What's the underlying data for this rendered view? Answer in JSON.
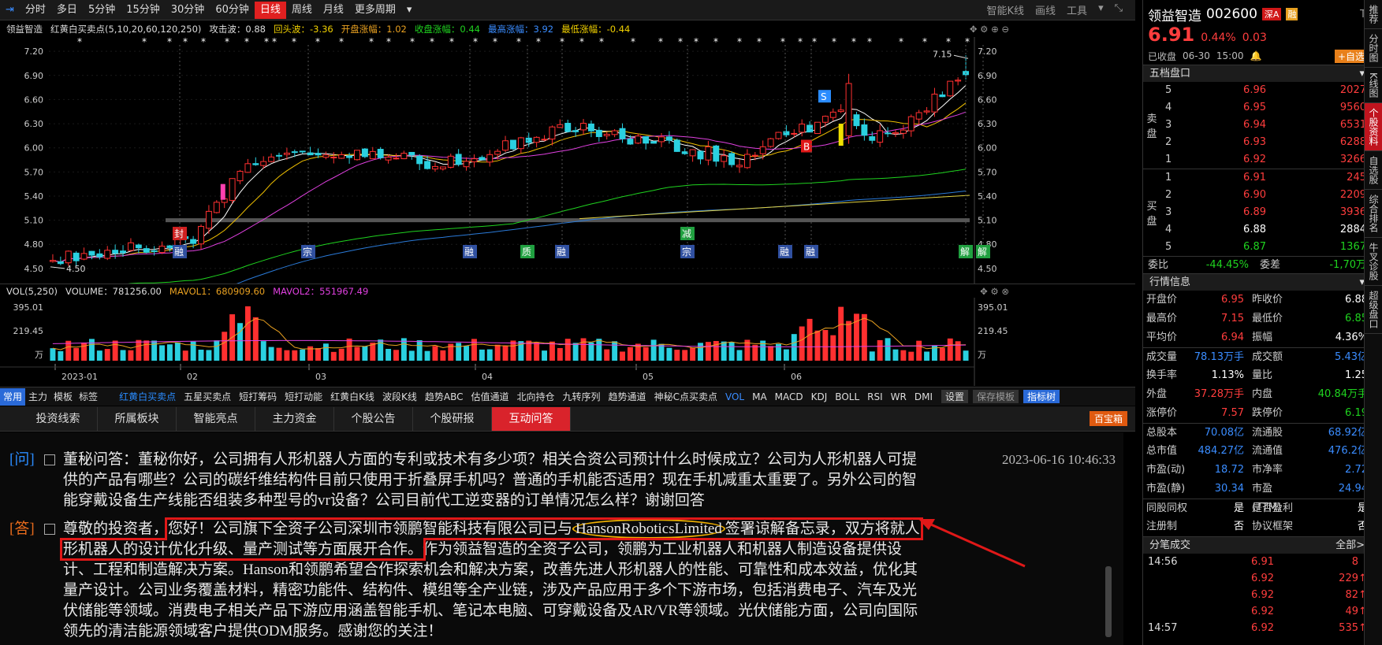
{
  "toolbar": {
    "periods": [
      "分时",
      "多日",
      "5分钟",
      "15分钟",
      "30分钟",
      "60分钟",
      "日线",
      "周线",
      "月线",
      "更多周期"
    ],
    "active_index": 6,
    "right": [
      "智能K线",
      "画线",
      "工具"
    ]
  },
  "indicator_line": {
    "name": "领益智造",
    "ma": "红黄白买卖点(5,10,20,60,120,250)",
    "items": [
      {
        "label": "攻击波：0.88",
        "color": "#ddd"
      },
      {
        "label": "回头波：-3.36",
        "color": "#f0d000"
      },
      {
        "label": "开盘涨幅：1.02",
        "color": "#e8a020"
      },
      {
        "label": "收盘涨幅：0.44",
        "color": "#1fd31f"
      },
      {
        "label": "最高涨幅：3.92",
        "color": "#3a8cff"
      },
      {
        "label": "最低涨幅：-0.44",
        "color": "#f0d000"
      }
    ]
  },
  "vol_line": {
    "name": "VOL(5,250)",
    "volume": "VOLUME：781256.00",
    "mavol1": "MAVOL1：680909.60",
    "mavol2": "MAVOL2：551967.49"
  },
  "chart_data": {
    "type": "candlestick",
    "y_ticks": [
      "7.20",
      "6.90",
      "6.60",
      "6.30",
      "6.00",
      "5.70",
      "5.40",
      "5.10",
      "4.80",
      "4.50"
    ],
    "ylim": [
      4.44,
      7.28
    ],
    "x_ticks": [
      "2023-01",
      "02",
      "03",
      "04",
      "05",
      "06"
    ],
    "annotations": {
      "high": "7.15",
      "low": "4.50"
    },
    "signals": [
      "封",
      "融",
      "宗",
      "融",
      "质",
      "融",
      "减",
      "宗",
      "融",
      "融",
      "解",
      "解"
    ],
    "vol_ticks": [
      "395.01",
      "219.45",
      "万"
    ],
    "seed": 20230630
  },
  "indicator_tabs": {
    "left": [
      "常用",
      "主力",
      "模板",
      "标签"
    ],
    "items": [
      "红黄白买卖点",
      "五星买卖点",
      "短打筹码",
      "短打动能",
      "红黄白K线",
      "波段K线",
      "趋势ABC",
      "估值通道",
      "北向持仓",
      "九转序列",
      "趋势通道",
      "神秘C点买卖点",
      "VOL",
      "MA",
      "MACD",
      "KDJ",
      "BOLL",
      "RSI",
      "WR",
      "DMI"
    ],
    "settings": "设置",
    "save": "保存模板",
    "tree": "指标树"
  },
  "info_tabs": {
    "items": [
      "投资线索",
      "所属板块",
      "智能亮点",
      "主力资金",
      "个股公告",
      "个股研报",
      "互动问答"
    ],
    "active_index": 6,
    "button": "百宝箱"
  },
  "qa": {
    "q_tag": "[问]",
    "question": "董秘问答：董秘你好，公司拥有人形机器人方面的专利或技术有多少项？相关合资公司预计什么时候成立？公司为人形机器人可提供的产品有哪些？公司的碳纤维结构件目前只使用于折叠屏手机吗？普通的手机能否适用？现在手机减重太重要了。另外公司的智能穿戴设备生产线能否组装多种型号的vr设备？公司目前代工逆变器的订单情况怎么样？谢谢回答",
    "time": "2023-06-16 10:46:33",
    "a_tag": "[答]",
    "answer_pre": "尊敬的投资者，",
    "answer_hl1": "您好！公司旗下全资子公司深圳市领鹏智能科技有限公司已与",
    "answer_hl_name": "HansonRoboticsLimited",
    "answer_hl2": "签署谅解备忘录，双方将就人形机器人的设计优化升级、量产测试等方面展开合作。",
    "answer_rest": "作为领益智造的全资子公司，领鹏为工业机器人和机器人制造设备提供设计、工程和制造解决方案。Hanson和领鹏希望合作探索机会和解决方案，改善先进人形机器人的性能、可靠性和成本效益，优化其量产设计。公司业务覆盖材料，精密功能件、结构件、模组等全产业链，涉及产品应用于多个下游市场，包括消费电子、汽车及光伏储能等领域。消费电子相关产品下游应用涵盖智能手机、笔记本电脑、可穿戴设备及AR/VR等领域。光伏储能方面，公司向国际领先的清洁能源领域客户提供ODM服务。感谢您的关注！"
  },
  "quote": {
    "name": "领益智造",
    "code": "002600",
    "tag1": "深A",
    "tag2": "融",
    "price": "6.91",
    "pct": "0.44%",
    "chg": "0.03",
    "status": "已收盘",
    "date": "06-30",
    "time": "15:00",
    "add": "+自选"
  },
  "order_book": {
    "title": "五档盘口",
    "sell_label": [
      "卖",
      "盘"
    ],
    "buy_label": [
      "买",
      "盘"
    ],
    "sell": [
      [
        "5",
        "6.96",
        "2027"
      ],
      [
        "4",
        "6.95",
        "9560"
      ],
      [
        "3",
        "6.94",
        "6531"
      ],
      [
        "2",
        "6.93",
        "6288"
      ],
      [
        "1",
        "6.92",
        "3266"
      ]
    ],
    "buy": [
      [
        "1",
        "6.91",
        "245"
      ],
      [
        "2",
        "6.90",
        "2209"
      ],
      [
        "3",
        "6.89",
        "3936"
      ],
      [
        "4",
        "6.88",
        "2884"
      ],
      [
        "5",
        "6.87",
        "1367"
      ]
    ],
    "ratio_label": "委比",
    "ratio": "-44.45%",
    "diff_label": "委差",
    "diff": "-1,70万"
  },
  "market": {
    "title": "行情信息",
    "rows": [
      [
        "开盘价",
        "6.95",
        "red",
        "昨收价",
        "6.88",
        "white"
      ],
      [
        "最高价",
        "7.15",
        "red",
        "最低价",
        "6.85",
        "green"
      ],
      [
        "平均价",
        "6.94",
        "red",
        "振幅",
        "4.36%",
        "white"
      ],
      [
        "成交量",
        "78.13万手",
        "blue",
        "成交额",
        "5.43亿",
        "blue"
      ],
      [
        "换手率",
        "1.13%",
        "white",
        "量比",
        "1.25",
        "white"
      ],
      [
        "外盘",
        "37.28万手",
        "red",
        "内盘",
        "40.84万手",
        "green"
      ],
      [
        "涨停价",
        "7.57",
        "red",
        "跌停价",
        "6.19",
        "green"
      ],
      [
        "总股本",
        "70.08亿",
        "blue",
        "流通股",
        "68.92亿",
        "blue"
      ],
      [
        "总市值",
        "484.27亿",
        "blue",
        "流通值",
        "476.2亿",
        "blue"
      ],
      [
        "市盈(动)",
        "18.72",
        "blue",
        "市净率",
        "2.72",
        "blue"
      ],
      [
        "市盈(静)",
        "30.34",
        "blue",
        "市盈(TTM)",
        "24.94",
        "blue"
      ],
      [
        "同股同权",
        "是",
        "white",
        "是否盈利",
        "是",
        "white"
      ],
      [
        "注册制",
        "否",
        "white",
        "协议框架",
        "否",
        "white"
      ]
    ]
  },
  "trades": {
    "title": "分笔成交",
    "all": "全部>",
    "rows": [
      [
        "14:56",
        "6.91",
        "8"
      ],
      [
        "",
        "6.92",
        "229"
      ],
      [
        "",
        "6.92",
        "82"
      ],
      [
        "",
        "6.92",
        "49"
      ],
      [
        "14:57",
        "6.92",
        "535"
      ]
    ]
  },
  "sidebar": [
    "推荐",
    "分时图",
    "K线图",
    "个股资料",
    "自选股",
    "综合排名",
    "牛叉诊股",
    "超级盘口"
  ]
}
